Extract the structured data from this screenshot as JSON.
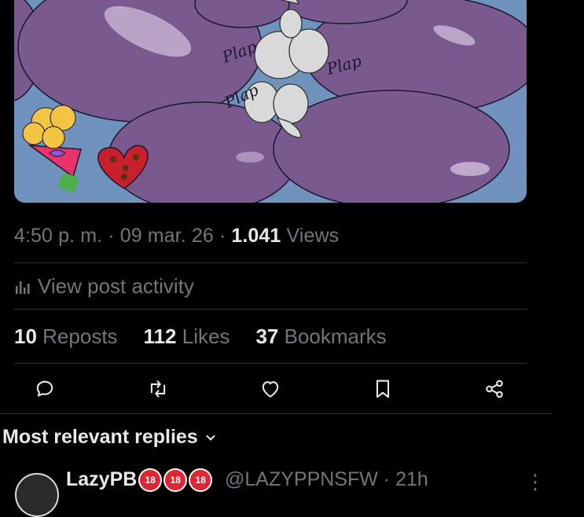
{
  "post": {
    "time": "4:50 p. m.",
    "date": "09 mar. 26",
    "views_count": "1.041",
    "views_label": "Views",
    "activity_label": "View post activity",
    "media_texts": [
      "Plap",
      "Plap",
      "Plap"
    ]
  },
  "stats": [
    {
      "count": "10",
      "label": "Reposts"
    },
    {
      "count": "112",
      "label": "Likes"
    },
    {
      "count": "37",
      "label": "Bookmarks"
    }
  ],
  "actions": [
    {
      "icon": "reply-icon"
    },
    {
      "icon": "repost-icon"
    },
    {
      "icon": "like-icon"
    },
    {
      "icon": "bookmark-icon"
    },
    {
      "icon": "share-icon"
    }
  ],
  "replies": {
    "sort_label": "Most relevant replies",
    "first": {
      "name": "LazyPB",
      "badges": [
        "18",
        "18",
        "18"
      ],
      "handle": "@LAZYPPNSFW · 21h"
    }
  },
  "colors": {
    "background": "#000000",
    "secondary_text": "#71767b",
    "primary_text": "#e7e9ea",
    "divider": "#2f3336",
    "media_bg": "#6f93bd",
    "media_purple": "#7a5a8e"
  }
}
